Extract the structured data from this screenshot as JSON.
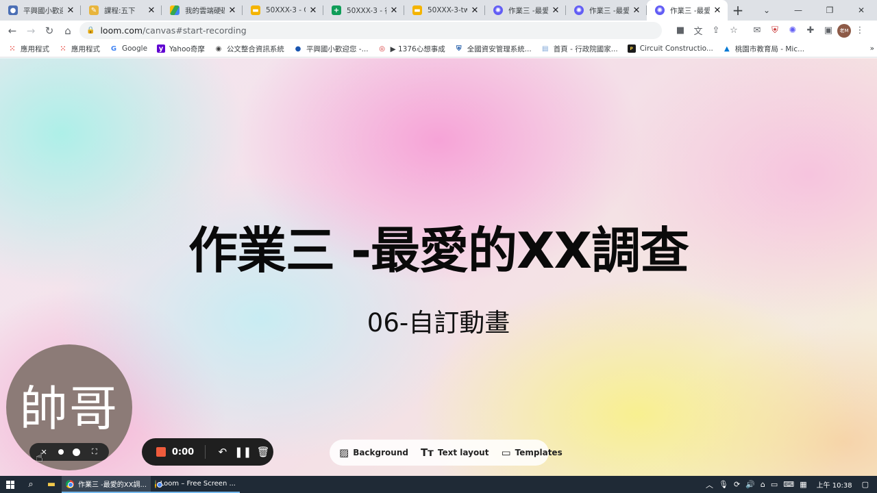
{
  "browser": {
    "tabs": [
      {
        "title": "平興國小歡迎",
        "icon": "globe-icon",
        "color": "#4b6fb5"
      },
      {
        "title": "課程:五下",
        "icon": "classroom-icon",
        "color": "#e8b53c"
      },
      {
        "title": "我的雲端硬碟",
        "icon": "drive-icon",
        "color": "#34a853"
      },
      {
        "title": "50XXX-3 - Go",
        "icon": "slides-icon",
        "color": "#f4b400"
      },
      {
        "title": "50XXX-3 - 行",
        "icon": "sheets-icon",
        "color": "#0f9d58"
      },
      {
        "title": "50XXX-3-tw",
        "icon": "slides-icon",
        "color": "#f4b400"
      },
      {
        "title": "作業三 -最愛",
        "icon": "loom-icon",
        "color": "#625df5"
      },
      {
        "title": "作業三 -最愛",
        "icon": "loom-icon",
        "color": "#625df5"
      },
      {
        "title": "作業三 -最愛",
        "icon": "loom-icon",
        "color": "#625df5",
        "active": true
      }
    ],
    "new_tab": "+",
    "url_domain": "loom.com",
    "url_path": "/canvas#start-recording",
    "profile_initials": "老M",
    "bookmarks": [
      {
        "label": "應用程式",
        "icon": "apps-icon"
      },
      {
        "label": "應用程式",
        "icon": "apps-icon"
      },
      {
        "label": "Google",
        "icon": "google-icon"
      },
      {
        "label": "Yahoo奇摩",
        "icon": "yahoo-icon"
      },
      {
        "label": "公文整合資訊系統",
        "icon": "globe-icon"
      },
      {
        "label": "平興國小歡迎您 -...",
        "icon": "globe-icon"
      },
      {
        "label": "▶ 1376心想事成",
        "icon": "target-icon"
      },
      {
        "label": "全國資安管理系統...",
        "icon": "shield-icon"
      },
      {
        "label": "首頁 - 行政院國家...",
        "icon": "page-icon"
      },
      {
        "label": "Circuit Constructio...",
        "icon": "phet-icon"
      },
      {
        "label": "桃園市教育局 - Mic...",
        "icon": "azure-icon"
      }
    ]
  },
  "slide": {
    "title": "作業三 -最愛的XX調查",
    "subtitle": "06-自訂動畫"
  },
  "camera": {
    "label": "帥哥"
  },
  "recorder": {
    "time": "0:00"
  },
  "canvas_toolbar": {
    "background": "Background",
    "text_layout": "Text layout",
    "templates": "Templates"
  },
  "taskbar": {
    "apps": [
      {
        "label": "作業三 -最愛的XX調..."
      },
      {
        "label": "Loom – Free Screen ..."
      }
    ],
    "clock": "上午 10:38"
  }
}
